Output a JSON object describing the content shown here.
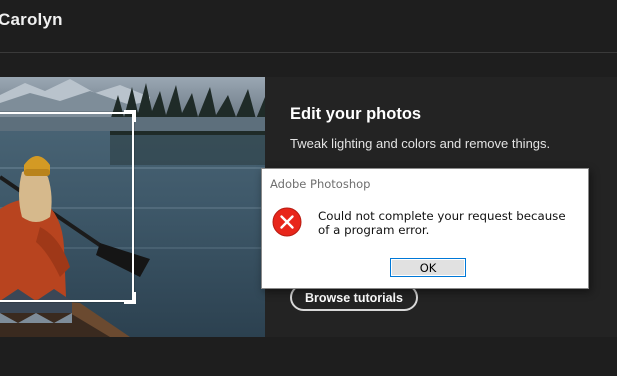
{
  "header": {
    "greeting": "Carolyn"
  },
  "card": {
    "title": "Edit your photos",
    "description": "Tweak lighting and colors and remove things.",
    "browse_label": "Browse tutorials"
  },
  "dialog": {
    "title": "Adobe Photoshop",
    "message": "Could not complete your request because of a program error.",
    "ok_label": "OK",
    "icon": "error-icon"
  },
  "colors": {
    "background": "#1e1e1e",
    "panel": "#232323",
    "error_red": "#e8261b",
    "focus_blue": "#0078d7"
  }
}
